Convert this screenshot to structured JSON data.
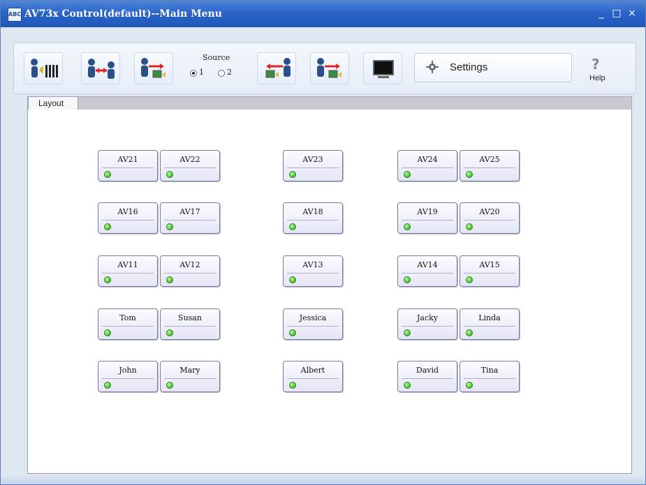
{
  "window": {
    "title": "AV73x Control(default)--Main Menu",
    "app_icon_text": "ABC",
    "controls": {
      "minimize": "_",
      "maximize": "□",
      "close": "×"
    }
  },
  "toolbar": {
    "source_label": "Source",
    "source_options": [
      "1",
      "2"
    ],
    "source_selected": "1",
    "settings_label": "Settings",
    "help_label": "Help",
    "help_glyph": "?"
  },
  "tabs": {
    "active_label": "Layout"
  },
  "devices": [
    {
      "label": "AV21",
      "status": "online"
    },
    {
      "label": "AV22",
      "status": "online"
    },
    {
      "label": "AV23",
      "status": "online"
    },
    {
      "label": "AV24",
      "status": "online"
    },
    {
      "label": "AV25",
      "status": "online"
    },
    {
      "label": "AV16",
      "status": "online"
    },
    {
      "label": "AV17",
      "status": "online"
    },
    {
      "label": "AV18",
      "status": "online"
    },
    {
      "label": "AV19",
      "status": "online"
    },
    {
      "label": "AV20",
      "status": "online"
    },
    {
      "label": "AV11",
      "status": "online"
    },
    {
      "label": "AV12",
      "status": "online"
    },
    {
      "label": "AV13",
      "status": "online"
    },
    {
      "label": "AV14",
      "status": "online"
    },
    {
      "label": "AV15",
      "status": "online"
    },
    {
      "label": "Tom",
      "status": "online"
    },
    {
      "label": "Susan",
      "status": "online"
    },
    {
      "label": "Jessica",
      "status": "online"
    },
    {
      "label": "Jacky",
      "status": "online"
    },
    {
      "label": "Linda",
      "status": "online"
    },
    {
      "label": "John",
      "status": "online"
    },
    {
      "label": "Mary",
      "status": "online"
    },
    {
      "label": "Albert",
      "status": "online"
    },
    {
      "label": "David",
      "status": "online"
    },
    {
      "label": "Tina",
      "status": "online"
    }
  ],
  "colors": {
    "status_online": "#57d23b",
    "titlebar": "#2a64c8"
  }
}
